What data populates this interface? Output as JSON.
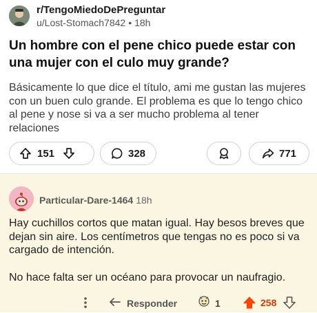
{
  "post": {
    "subreddit": "r/TengoMiedoDePreguntar",
    "author": "u/Lost-Stomach7842",
    "separator": "•",
    "age": "18h",
    "title": "Un hombre con el pene chico puede estar con una mujer con el culo muy grande?",
    "body": "Básicamente lo que dice el título, ami me gustan las mujeres con un buen culo grande. El problema es que lo tengo chico al pene y nose si va a ser mucho problema al tener relaciones",
    "votes": "151",
    "comments": "328",
    "shares": "771"
  },
  "comment": {
    "author": "Particular-Dare-1464",
    "age": "18h",
    "paragraphs": [
      "Hay cuchillos cortos que matan igual. Hay besos breves que dejan sin aire. Los centímetros que tengas no es poco si va cargado de intención.",
      "No hace falta ser un océano para provocar un naufragio."
    ],
    "reply_label": "Responder",
    "award_count": "1",
    "score": "258"
  },
  "colors": {
    "comment_background": "#fbf6e2",
    "upvote_accent": "#ff4500",
    "score_text": "#d93a00",
    "pill_border": "#cfd2d4"
  },
  "icons": {
    "post_avatar": "community-avatar-icon",
    "comment_avatar": "snoo-avatar-icon",
    "upvote": "arrow-up-icon",
    "downvote": "arrow-down-icon",
    "comment": "speech-bubble-icon",
    "award": "award-icon",
    "share": "share-arrow-icon",
    "more": "vertical-dots-icon",
    "reply": "reply-arrow-icon"
  }
}
